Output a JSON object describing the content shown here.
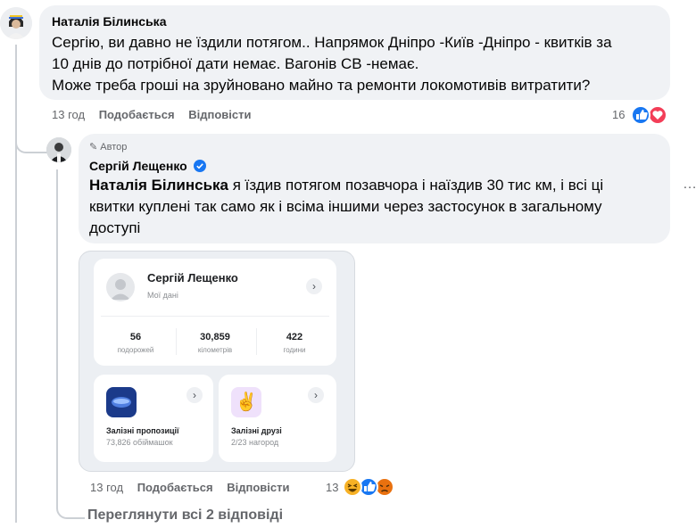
{
  "comment1": {
    "author": "Наталія Білинська",
    "lines": [
      "Сергію, ви давно не їздили потягом.. Напрямок Дніпро -Київ -Дніпро - квитків за",
      "10 днів до потрібної дати немає. Вагонів СВ -немає.",
      "Може треба гроші на зруйновано майно та ремонти локомотивів витратити?"
    ],
    "time": "13 год",
    "like_label": "Подобається",
    "reply_label": "Відповісти",
    "reaction_count": "16",
    "reactions": [
      "like",
      "love"
    ]
  },
  "reply": {
    "badge": "Автор",
    "author": "Сергій Лещенко",
    "mention": "Наталія Білинська",
    "lines": [
      "я їздив потягом позавчора і наїздив 30 тис км, і всі ці",
      "квитки куплені так само як і всіма іншими через застосунок в загальному",
      "доступі"
    ],
    "time": "13 год",
    "like_label": "Подобається",
    "reply_label": "Відповісти",
    "reaction_count": "13",
    "reactions": [
      "haha",
      "like",
      "angry"
    ],
    "more_icon": "…",
    "colors": {
      "verified": "#1877f2",
      "like": "#1877f2",
      "love": "#f33e58",
      "haha": "#f7b125",
      "angry": "#e9710f"
    }
  },
  "app_card": {
    "profile_name": "Сергій Лещенко",
    "profile_sub": "Мої дані",
    "stats": [
      {
        "value": "56",
        "label": "подорожей"
      },
      {
        "value": "30,859",
        "label": "кілометрів"
      },
      {
        "value": "422",
        "label": "години"
      }
    ],
    "tile1": {
      "title": "Залізні пропозиції",
      "sub": "73,826 обіймашок",
      "icon": "rail-offers-icon"
    },
    "tile2": {
      "title": "Залізні друзі",
      "sub": "2/23 нагород",
      "icon": "victory-hand-icon"
    }
  },
  "view_replies": "Переглянути всі 2 відповіді"
}
